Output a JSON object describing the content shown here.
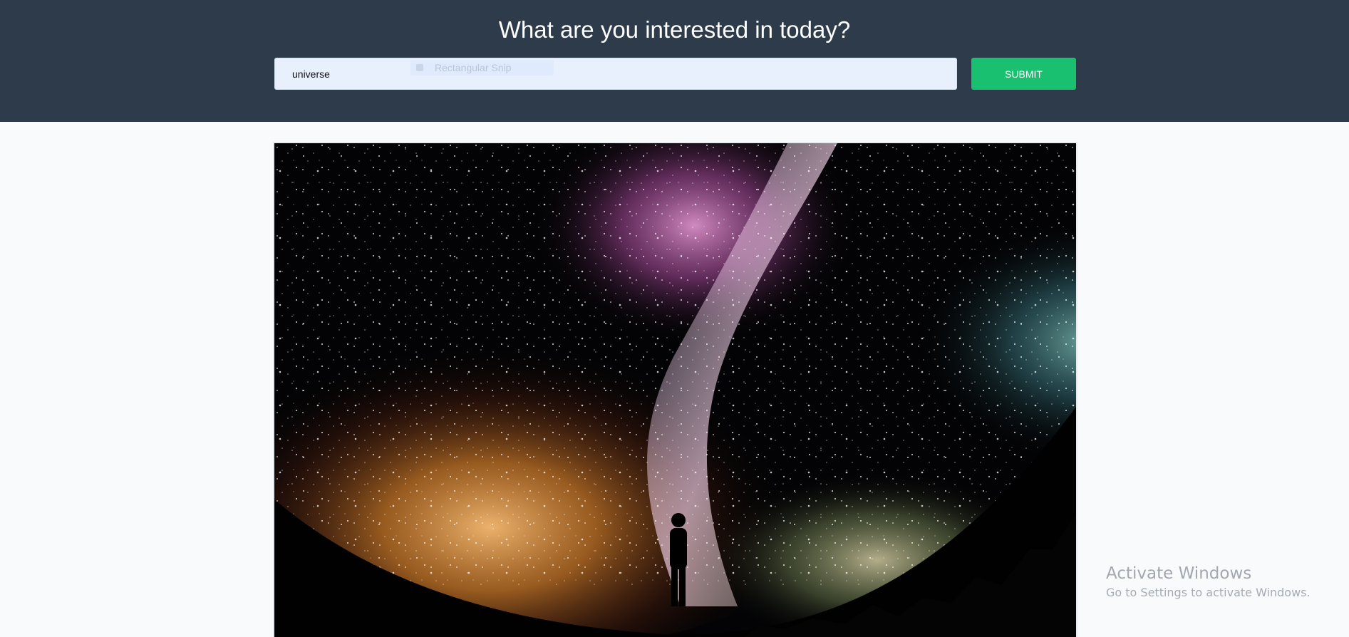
{
  "header": {
    "title": "What are you interested in today?"
  },
  "search": {
    "value": "universe",
    "submit_label": "SUBMIT"
  },
  "snip_tooltip": {
    "label": "Rectangular Snip"
  },
  "result": {
    "image_icon": "starry-sky-image"
  },
  "watermark": {
    "title": "Activate Windows",
    "subtitle": "Go to Settings to activate Windows."
  },
  "colors": {
    "header_bg": "#2d3b4a",
    "page_bg": "#f8fafc",
    "submit_bg": "#18c070",
    "input_bg": "#e8f0fe"
  }
}
